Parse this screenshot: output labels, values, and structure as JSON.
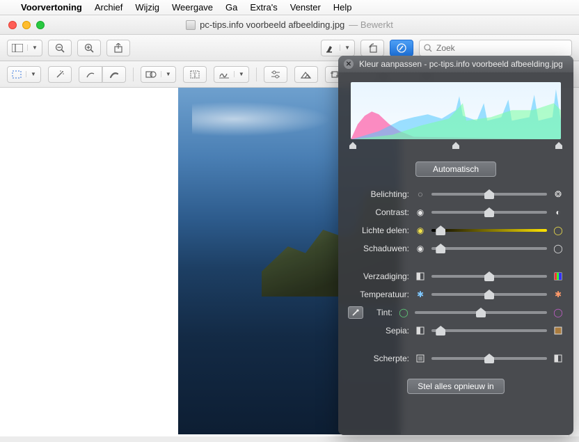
{
  "menubar": {
    "app": "Voorvertoning",
    "items": [
      "Archief",
      "Wijzig",
      "Weergave",
      "Ga",
      "Extra's",
      "Venster",
      "Help"
    ]
  },
  "titlebar": {
    "document": "pc-tips.info voorbeeld afbeelding.jpg",
    "state": "— Bewerkt"
  },
  "toolbar": {
    "search_placeholder": "Zoek"
  },
  "panel": {
    "title": "Kleur aanpassen - pc-tips.info voorbeeld afbeelding.jpg",
    "auto_label": "Automatisch",
    "reset_label": "Stel alles opnieuw in",
    "sliders": {
      "exposure": {
        "label": "Belichting:",
        "value": 50
      },
      "contrast": {
        "label": "Contrast:",
        "value": 50
      },
      "highlights": {
        "label": "Lichte delen:",
        "value": 6
      },
      "shadows": {
        "label": "Schaduwen:",
        "value": 6
      },
      "saturation": {
        "label": "Verzadiging:",
        "value": 50
      },
      "temperature": {
        "label": "Temperatuur:",
        "value": 50
      },
      "tint": {
        "label": "Tint:",
        "value": 50
      },
      "sepia": {
        "label": "Sepia:",
        "value": 6
      },
      "sharpness": {
        "label": "Scherpte:",
        "value": 50
      }
    }
  }
}
